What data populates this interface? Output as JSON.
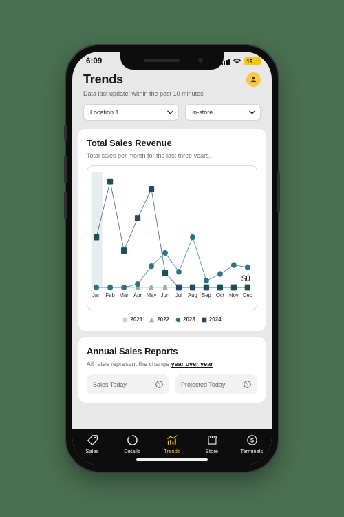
{
  "device": {
    "status_bar": {
      "time": "6:09",
      "signal_icon": "cellular-signal-icon",
      "wifi_icon": "wifi-icon",
      "battery_level": "19",
      "battery_charging_glyph": "⚡",
      "battery_icon": "battery-charging-icon"
    }
  },
  "header": {
    "title": "Trends",
    "avatar_icon": "user-avatar-icon",
    "subtitle": "Data last update: within the past 10 minutes"
  },
  "filters": {
    "location": {
      "value": "Location 1",
      "chevron_icon": "chevron-down-icon"
    },
    "channel": {
      "value": "in-store",
      "chevron_icon": "chevron-down-icon"
    }
  },
  "revenue_card": {
    "title": "Total Sales Revenue",
    "subtitle": "Total sales per month for the last three years.",
    "zero_label": "$0"
  },
  "annual_card": {
    "title": "Annual Sales Reports",
    "subtitle_prefix": "All rates represent the change ",
    "subtitle_emphasis": "year over year",
    "tiles": [
      {
        "label": "Sales Today",
        "help_icon": "question-mark-circle-icon"
      },
      {
        "label": "Projected Today",
        "help_icon": "question-mark-circle-icon"
      }
    ]
  },
  "tabbar": {
    "items": [
      {
        "label": "Sales",
        "icon": "tag-icon",
        "active": false
      },
      {
        "label": "Details",
        "icon": "donut-chart-icon",
        "active": false
      },
      {
        "label": "Trends",
        "icon": "bar-chart-trend-icon",
        "active": true
      },
      {
        "label": "Store",
        "icon": "storefront-icon",
        "active": false
      },
      {
        "label": "Terminals",
        "icon": "dollar-circle-icon",
        "active": false
      }
    ]
  },
  "colors": {
    "page_background": "#4a7050",
    "accent_yellow": "#f5c518",
    "series_2021": "#c3d3da",
    "series_2022": "#8fadb9",
    "series_2023": "#2f7286",
    "series_2024": "#1f4f5e",
    "grid_line": "#b9c6cc",
    "highlight_band": "#e6edf0"
  },
  "chart_data": {
    "type": "line",
    "title": "Total Sales Revenue",
    "subtitle": "Total sales per month for the last three years.",
    "xlabel": "",
    "ylabel": "",
    "categories": [
      "Jan",
      "Feb",
      "Mar",
      "Apr",
      "May",
      "Jun",
      "Jul",
      "Aug",
      "Sep",
      "Oct",
      "Nov",
      "Dec"
    ],
    "ylim": [
      0,
      100
    ],
    "grid": false,
    "legend_position": "bottom",
    "zero_annotation": "$0",
    "highlighted_category": "Jan",
    "series": [
      {
        "name": "2021",
        "marker": "square-small",
        "color": "#c3d3da",
        "values": [
          0,
          0,
          0,
          0,
          0,
          0,
          0,
          0,
          0,
          0,
          0,
          0
        ]
      },
      {
        "name": "2022",
        "marker": "triangle",
        "color": "#8fadb9",
        "values": [
          0,
          0,
          0,
          0,
          0,
          0,
          0,
          0,
          0,
          0,
          0,
          0
        ]
      },
      {
        "name": "2023",
        "marker": "circle",
        "color": "#2f7286",
        "values": [
          0,
          0,
          0,
          3,
          19,
          31,
          14,
          45,
          6,
          12,
          20,
          18
        ]
      },
      {
        "name": "2024",
        "marker": "square",
        "color": "#1f4f5e",
        "values": [
          45,
          95,
          33,
          62,
          88,
          13,
          0,
          0,
          0,
          0,
          0,
          0
        ]
      }
    ]
  }
}
